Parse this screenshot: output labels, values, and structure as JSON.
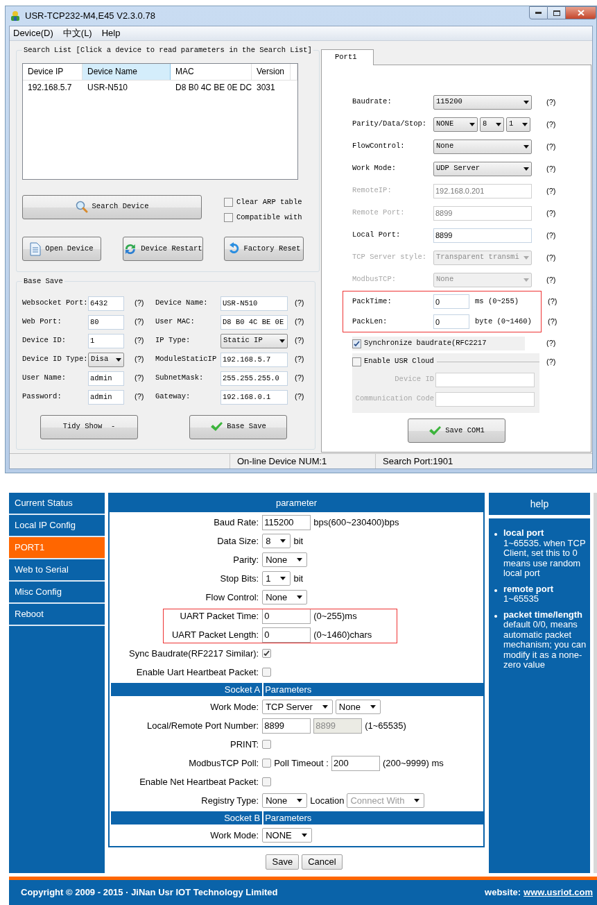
{
  "app": {
    "title": "USR-TCP232-M4,E45 V2.3.0.78",
    "menu": [
      "Device(D)",
      "中文(L)",
      "Help"
    ],
    "search_list": {
      "title": "Search List [Click a device to read parameters in the Search List]",
      "columns": [
        {
          "label": "Device IP",
          "selected": false
        },
        {
          "label": "Device Name",
          "selected": true
        },
        {
          "label": "MAC",
          "selected": false
        },
        {
          "label": "Version",
          "selected": false
        }
      ],
      "rows": [
        [
          "192.168.5.7",
          "USR-N510",
          "D8 B0 4C BE 0E DC",
          "3031"
        ]
      ],
      "search_button": "Search Device",
      "options": [
        {
          "label": "Clear ARP table",
          "checked": false
        },
        {
          "label": "Compatible with",
          "checked": false
        }
      ],
      "buttons": [
        "Open Device",
        "Device Restart",
        "Factory Reset"
      ]
    },
    "base_save": {
      "title": "Base Save",
      "left": [
        {
          "kind": "input",
          "label": "Websocket Port:",
          "value": "6432",
          "help": "(?)"
        },
        {
          "kind": "input",
          "label": "Web Port:",
          "value": "80",
          "help": "(?)"
        },
        {
          "kind": "input",
          "label": "Device ID:",
          "value": "1",
          "help": "(?)"
        },
        {
          "kind": "select",
          "label": "Device ID Type:",
          "value": "Disa",
          "help": "(?)"
        },
        {
          "kind": "input",
          "label": "User Name:",
          "value": "admin",
          "help": "(?)"
        },
        {
          "kind": "input",
          "label": "Password:",
          "value": "admin",
          "help": "(?)"
        }
      ],
      "right": [
        {
          "kind": "input",
          "label": "Device Name:",
          "value": "USR-N510",
          "help": "(?)"
        },
        {
          "kind": "input",
          "label": "User MAC:",
          "value": "D8 B0 4C BE 0E",
          "help": "(?)"
        },
        {
          "kind": "select",
          "label": "IP Type:",
          "value": "Static IP",
          "help": "(?)"
        },
        {
          "kind": "input",
          "label": "ModuleStaticIP",
          "value": "192.168.5.7",
          "help": "(?)"
        },
        {
          "kind": "input",
          "label": "SubnetMask:",
          "value": "255.255.255.0",
          "help": "(?)"
        },
        {
          "kind": "input",
          "label": "Gateway:",
          "value": "192.168.0.1",
          "help": "(?)"
        }
      ],
      "buttons": [
        "Tidy Show  -",
        "Base Save"
      ]
    },
    "port": {
      "tab": "Port1",
      "fields": [
        {
          "kind": "select",
          "label": "Baudrate:",
          "value": "115200",
          "disabled": false,
          "help": "(?)"
        },
        {
          "kind": "selects",
          "label": "Parity/Data/Stop:",
          "values": [
            "NONE",
            "8",
            "1"
          ],
          "disabled": false,
          "help": "(?)"
        },
        {
          "kind": "select",
          "label": "FlowControl:",
          "value": "None",
          "disabled": false,
          "help": "(?)"
        },
        {
          "kind": "select",
          "label": "Work Mode:",
          "value": "UDP Server",
          "disabled": false,
          "help": "(?)"
        },
        {
          "kind": "input",
          "label": "RemoteIP:",
          "value": "192.168.0.201",
          "disabled": true,
          "help": "(?)"
        },
        {
          "kind": "input",
          "label": "Remote Port:",
          "value": "8899",
          "disabled": true,
          "help": "(?)"
        },
        {
          "kind": "input",
          "label": "Local Port:",
          "value": "8899",
          "disabled": false,
          "help": "(?)"
        },
        {
          "kind": "select",
          "label": "TCP Server style:",
          "value": "Transparent transmi",
          "disabled": true,
          "help": "(?)"
        },
        {
          "kind": "select",
          "label": "ModbusTCP:",
          "value": "None",
          "disabled": true,
          "help": "(?)"
        }
      ],
      "packet": {
        "highlighted": true,
        "fields": [
          {
            "label": "PackTime:",
            "value": "0",
            "unit": "ms (0~255)",
            "help": "(?)"
          },
          {
            "label": "PackLen:",
            "value": "0",
            "unit": "byte (0~1460)",
            "help": "(?)"
          }
        ]
      },
      "sync": {
        "label": "Synchronize baudrate(RFC2217",
        "checked": true,
        "help": "(?)"
      },
      "cloud": {
        "label": "Enable USR Cloud",
        "checked": false,
        "help": "(?)",
        "fields": [
          {
            "label": "Device ID"
          },
          {
            "label": "Communication Code"
          }
        ]
      },
      "save": "Save COM1"
    },
    "status_bar": [
      "On-line Device NUM:1",
      "Search Port:1901"
    ]
  },
  "web": {
    "nav": [
      {
        "label": "Current Status",
        "selected": false
      },
      {
        "label": "Local IP Config",
        "selected": false
      },
      {
        "label": "PORT1",
        "selected": true
      },
      {
        "label": "Web to Serial",
        "selected": false
      },
      {
        "label": "Misc Config",
        "selected": false
      },
      {
        "label": "Reboot",
        "selected": false
      }
    ],
    "panel_title": "parameter",
    "rows": [
      {
        "kind": "field",
        "label": "Baud Rate:",
        "controls": [
          {
            "kind": "input",
            "value": "115200",
            "disabled": false
          },
          {
            "kind": "text",
            "value": "bps(600~230400)bps"
          }
        ]
      },
      {
        "kind": "field",
        "label": "Data Size:",
        "controls": [
          {
            "kind": "select",
            "value": "8",
            "disabled": false
          },
          {
            "kind": "text",
            "value": "bit"
          }
        ]
      },
      {
        "kind": "field",
        "label": "Parity:",
        "controls": [
          {
            "kind": "select",
            "value": "None",
            "disabled": false
          }
        ]
      },
      {
        "kind": "field",
        "label": "Stop Bits:",
        "controls": [
          {
            "kind": "select",
            "value": "1",
            "disabled": false
          },
          {
            "kind": "text",
            "value": "bit"
          }
        ]
      },
      {
        "kind": "field",
        "label": "Flow Control:",
        "controls": [
          {
            "kind": "select",
            "value": "None",
            "disabled": false
          }
        ]
      },
      {
        "kind": "group",
        "highlighted": true,
        "rows": [
          {
            "kind": "field",
            "label": "UART Packet Time:",
            "controls": [
              {
                "kind": "input",
                "value": "0",
                "disabled": false
              },
              {
                "kind": "text",
                "value": "(0~255)ms"
              }
            ]
          },
          {
            "kind": "field",
            "label": "UART Packet Length:",
            "controls": [
              {
                "kind": "input",
                "value": "0",
                "disabled": false
              },
              {
                "kind": "text",
                "value": "(0~1460)chars"
              }
            ]
          }
        ]
      },
      {
        "kind": "field",
        "label": "Sync Baudrate(RF2217 Similar):",
        "controls": [
          {
            "kind": "checkbox",
            "checked": true
          }
        ]
      },
      {
        "kind": "field",
        "label": "Enable Uart Heartbeat Packet:",
        "controls": [
          {
            "kind": "checkbox",
            "checked": false
          }
        ]
      },
      {
        "kind": "section",
        "left": "Socket A",
        "right": "Parameters"
      },
      {
        "kind": "field",
        "label": "Work Mode:",
        "controls": [
          {
            "kind": "select",
            "value": "TCP Server",
            "disabled": false
          },
          {
            "kind": "select",
            "value": "None",
            "disabled": false
          }
        ]
      },
      {
        "kind": "field",
        "label": "Local/Remote Port Number:",
        "controls": [
          {
            "kind": "input",
            "value": "8899",
            "disabled": false
          },
          {
            "kind": "input",
            "value": "8899",
            "disabled": true
          },
          {
            "kind": "text",
            "value": "(1~65535)"
          }
        ]
      },
      {
        "kind": "field",
        "label": "PRINT:",
        "controls": [
          {
            "kind": "checkbox",
            "checked": false
          }
        ]
      },
      {
        "kind": "field",
        "label": "ModbusTCP Poll:",
        "controls": [
          {
            "kind": "checkbox",
            "checked": false
          },
          {
            "kind": "text",
            "value": "Poll Timeout :"
          },
          {
            "kind": "input",
            "value": "200",
            "disabled": false
          },
          {
            "kind": "text",
            "value": "(200~9999) ms"
          }
        ]
      },
      {
        "kind": "field",
        "label": "Enable Net Heartbeat Packet:",
        "controls": [
          {
            "kind": "checkbox",
            "checked": false
          }
        ]
      },
      {
        "kind": "field",
        "label": "Registry Type:",
        "controls": [
          {
            "kind": "select",
            "value": "None",
            "disabled": false
          },
          {
            "kind": "text",
            "value": "Location"
          },
          {
            "kind": "select",
            "value": "Connect With",
            "disabled": true
          }
        ]
      },
      {
        "kind": "section",
        "left": "Socket B",
        "right": "Parameters"
      },
      {
        "kind": "field",
        "label": "Work Mode:",
        "controls": [
          {
            "kind": "select",
            "value": "NONE",
            "disabled": false
          }
        ]
      }
    ],
    "buttons": [
      "Save",
      "Cancel"
    ],
    "help_title": "help",
    "help": [
      {
        "title": "local port",
        "text": "1~65535. when TCP Client, set this to 0 means use random local port"
      },
      {
        "title": "remote port",
        "text": "1~65535"
      },
      {
        "title": "packet time/length",
        "text": "default 0/0, means automatic packet mechanism; you can modify it as a none-zero value"
      }
    ],
    "footer": {
      "copyright": "Copyright © 2009 - 2015 · JiNan Usr IOT Technology Limited",
      "website_label": "website:",
      "website_link": "www.usriot.com"
    }
  }
}
